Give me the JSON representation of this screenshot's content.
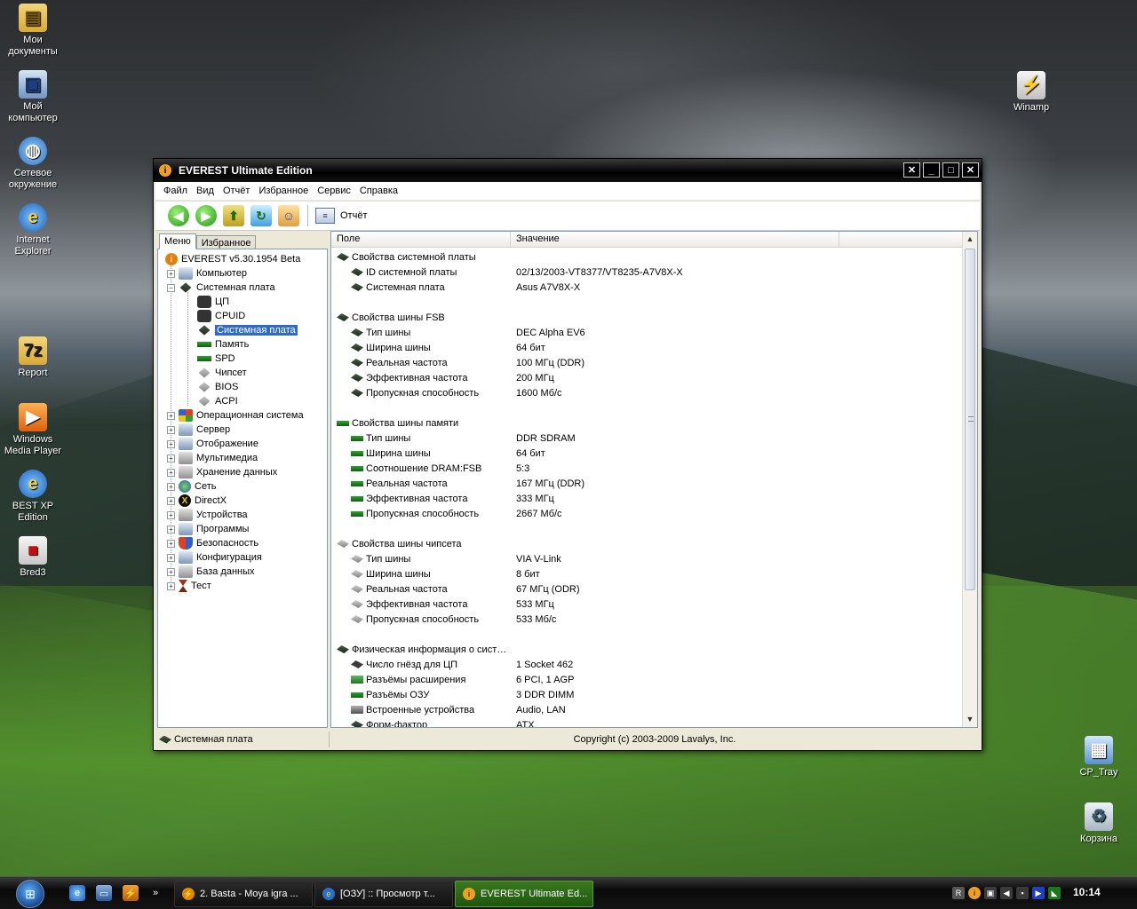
{
  "desktop_icons": [
    {
      "label_line1": "Мои",
      "label_line2": "документы",
      "icon": "folder-icon"
    },
    {
      "label_line1": "Мой",
      "label_line2": "компьютер",
      "icon": "computer-icon"
    },
    {
      "label_line1": "Сетевое",
      "label_line2": "окружение",
      "icon": "network-icon"
    },
    {
      "label_line1": "Internet",
      "label_line2": "Explorer",
      "icon": "ie-icon"
    },
    {
      "label_line1": "Report",
      "label_line2": "",
      "icon": "archive-folder-icon"
    },
    {
      "label_line1": "Windows",
      "label_line2": "Media Player",
      "icon": "media-player-icon"
    },
    {
      "label_line1": "BEST XP",
      "label_line2": "Edition",
      "icon": "ie-icon"
    },
    {
      "label_line1": "Bred3",
      "label_line2": "",
      "icon": "editor-icon"
    },
    {
      "label_line1": "Winamp",
      "label_line2": "",
      "icon": "winamp-icon"
    },
    {
      "label_line1": "CP_Tray",
      "label_line2": "",
      "icon": "cp-tray-icon"
    },
    {
      "label_line1": "Корзина",
      "label_line2": "",
      "icon": "recycle-bin-icon"
    }
  ],
  "window": {
    "title": "EVEREST Ultimate Edition",
    "menu": [
      "Файл",
      "Вид",
      "Отчёт",
      "Избранное",
      "Сервис",
      "Справка"
    ],
    "toolbar": {
      "report_label": "Отчёт"
    },
    "left_tabs": [
      "Меню",
      "Избранное"
    ],
    "tree": [
      {
        "label": "EVEREST v5.30.1954 Beta"
      },
      {
        "label": "Компьютер"
      },
      {
        "label": "Системная плата"
      },
      {
        "label": "ЦП"
      },
      {
        "label": "CPUID"
      },
      {
        "label": "Системная плата"
      },
      {
        "label": "Память"
      },
      {
        "label": "SPD"
      },
      {
        "label": "Чипсет"
      },
      {
        "label": "BIOS"
      },
      {
        "label": "ACPI"
      },
      {
        "label": "Операционная система"
      },
      {
        "label": "Сервер"
      },
      {
        "label": "Отображение"
      },
      {
        "label": "Мультимедиа"
      },
      {
        "label": "Хранение данных"
      },
      {
        "label": "Сеть"
      },
      {
        "label": "DirectX"
      },
      {
        "label": "Устройства"
      },
      {
        "label": "Программы"
      },
      {
        "label": "Безопасность"
      },
      {
        "label": "Конфигурация"
      },
      {
        "label": "База данных"
      },
      {
        "label": "Тест"
      }
    ],
    "columns": [
      "Поле",
      "Значение"
    ],
    "rows": [
      {
        "field": "Свойства системной платы",
        "value": ""
      },
      {
        "field": "ID системной платы",
        "value": "02/13/2003-VT8377/VT8235-A7V8X-X"
      },
      {
        "field": "Системная плата",
        "value": "Asus A7V8X-X"
      },
      {
        "field": "Свойства шины FSB",
        "value": ""
      },
      {
        "field": "Тип шины",
        "value": "DEC Alpha EV6"
      },
      {
        "field": "Ширина шины",
        "value": "64 бит"
      },
      {
        "field": "Реальная частота",
        "value": "100 МГц (DDR)"
      },
      {
        "field": "Эффективная частота",
        "value": "200 МГц"
      },
      {
        "field": "Пропускная способность",
        "value": "1600 Мб/с"
      },
      {
        "field": "Свойства шины памяти",
        "value": ""
      },
      {
        "field": "Тип шины",
        "value": "DDR SDRAM"
      },
      {
        "field": "Ширина шины",
        "value": "64 бит"
      },
      {
        "field": "Соотношение DRAM:FSB",
        "value": "5:3"
      },
      {
        "field": "Реальная частота",
        "value": "167 МГц (DDR)"
      },
      {
        "field": "Эффективная частота",
        "value": "333 МГц"
      },
      {
        "field": "Пропускная способность",
        "value": "2667 Мб/с"
      },
      {
        "field": "Свойства шины чипсета",
        "value": ""
      },
      {
        "field": "Тип шины",
        "value": "VIA V-Link"
      },
      {
        "field": "Ширина шины",
        "value": "8 бит"
      },
      {
        "field": "Реальная частота",
        "value": "67 МГц (ODR)"
      },
      {
        "field": "Эффективная частота",
        "value": "533 МГц"
      },
      {
        "field": "Пропускная способность",
        "value": "533 Мб/с"
      },
      {
        "field": "Физическая информация о сист…",
        "value": ""
      },
      {
        "field": "Число гнёзд для ЦП",
        "value": "1 Socket 462"
      },
      {
        "field": "Разъёмы расширения",
        "value": "6 PCI, 1 AGP"
      },
      {
        "field": "Разъёмы ОЗУ",
        "value": "3 DDR DIMM"
      },
      {
        "field": "Встроенные устройства",
        "value": "Audio, LAN"
      },
      {
        "field": "Форм-фактор",
        "value": "ATX"
      }
    ],
    "status": {
      "left": "Системная плата",
      "copyright": "Copyright (c) 2003-2009 Lavalys, Inc."
    }
  },
  "taskbar": {
    "tasks": [
      {
        "label": "2. Basta - Moya igra ..."
      },
      {
        "label": "[ОЗУ] :: Просмотр т..."
      },
      {
        "label": "EVEREST Ultimate Ed..."
      }
    ],
    "tray_lang": "R",
    "clock": "10:14",
    "chevron": "»"
  }
}
